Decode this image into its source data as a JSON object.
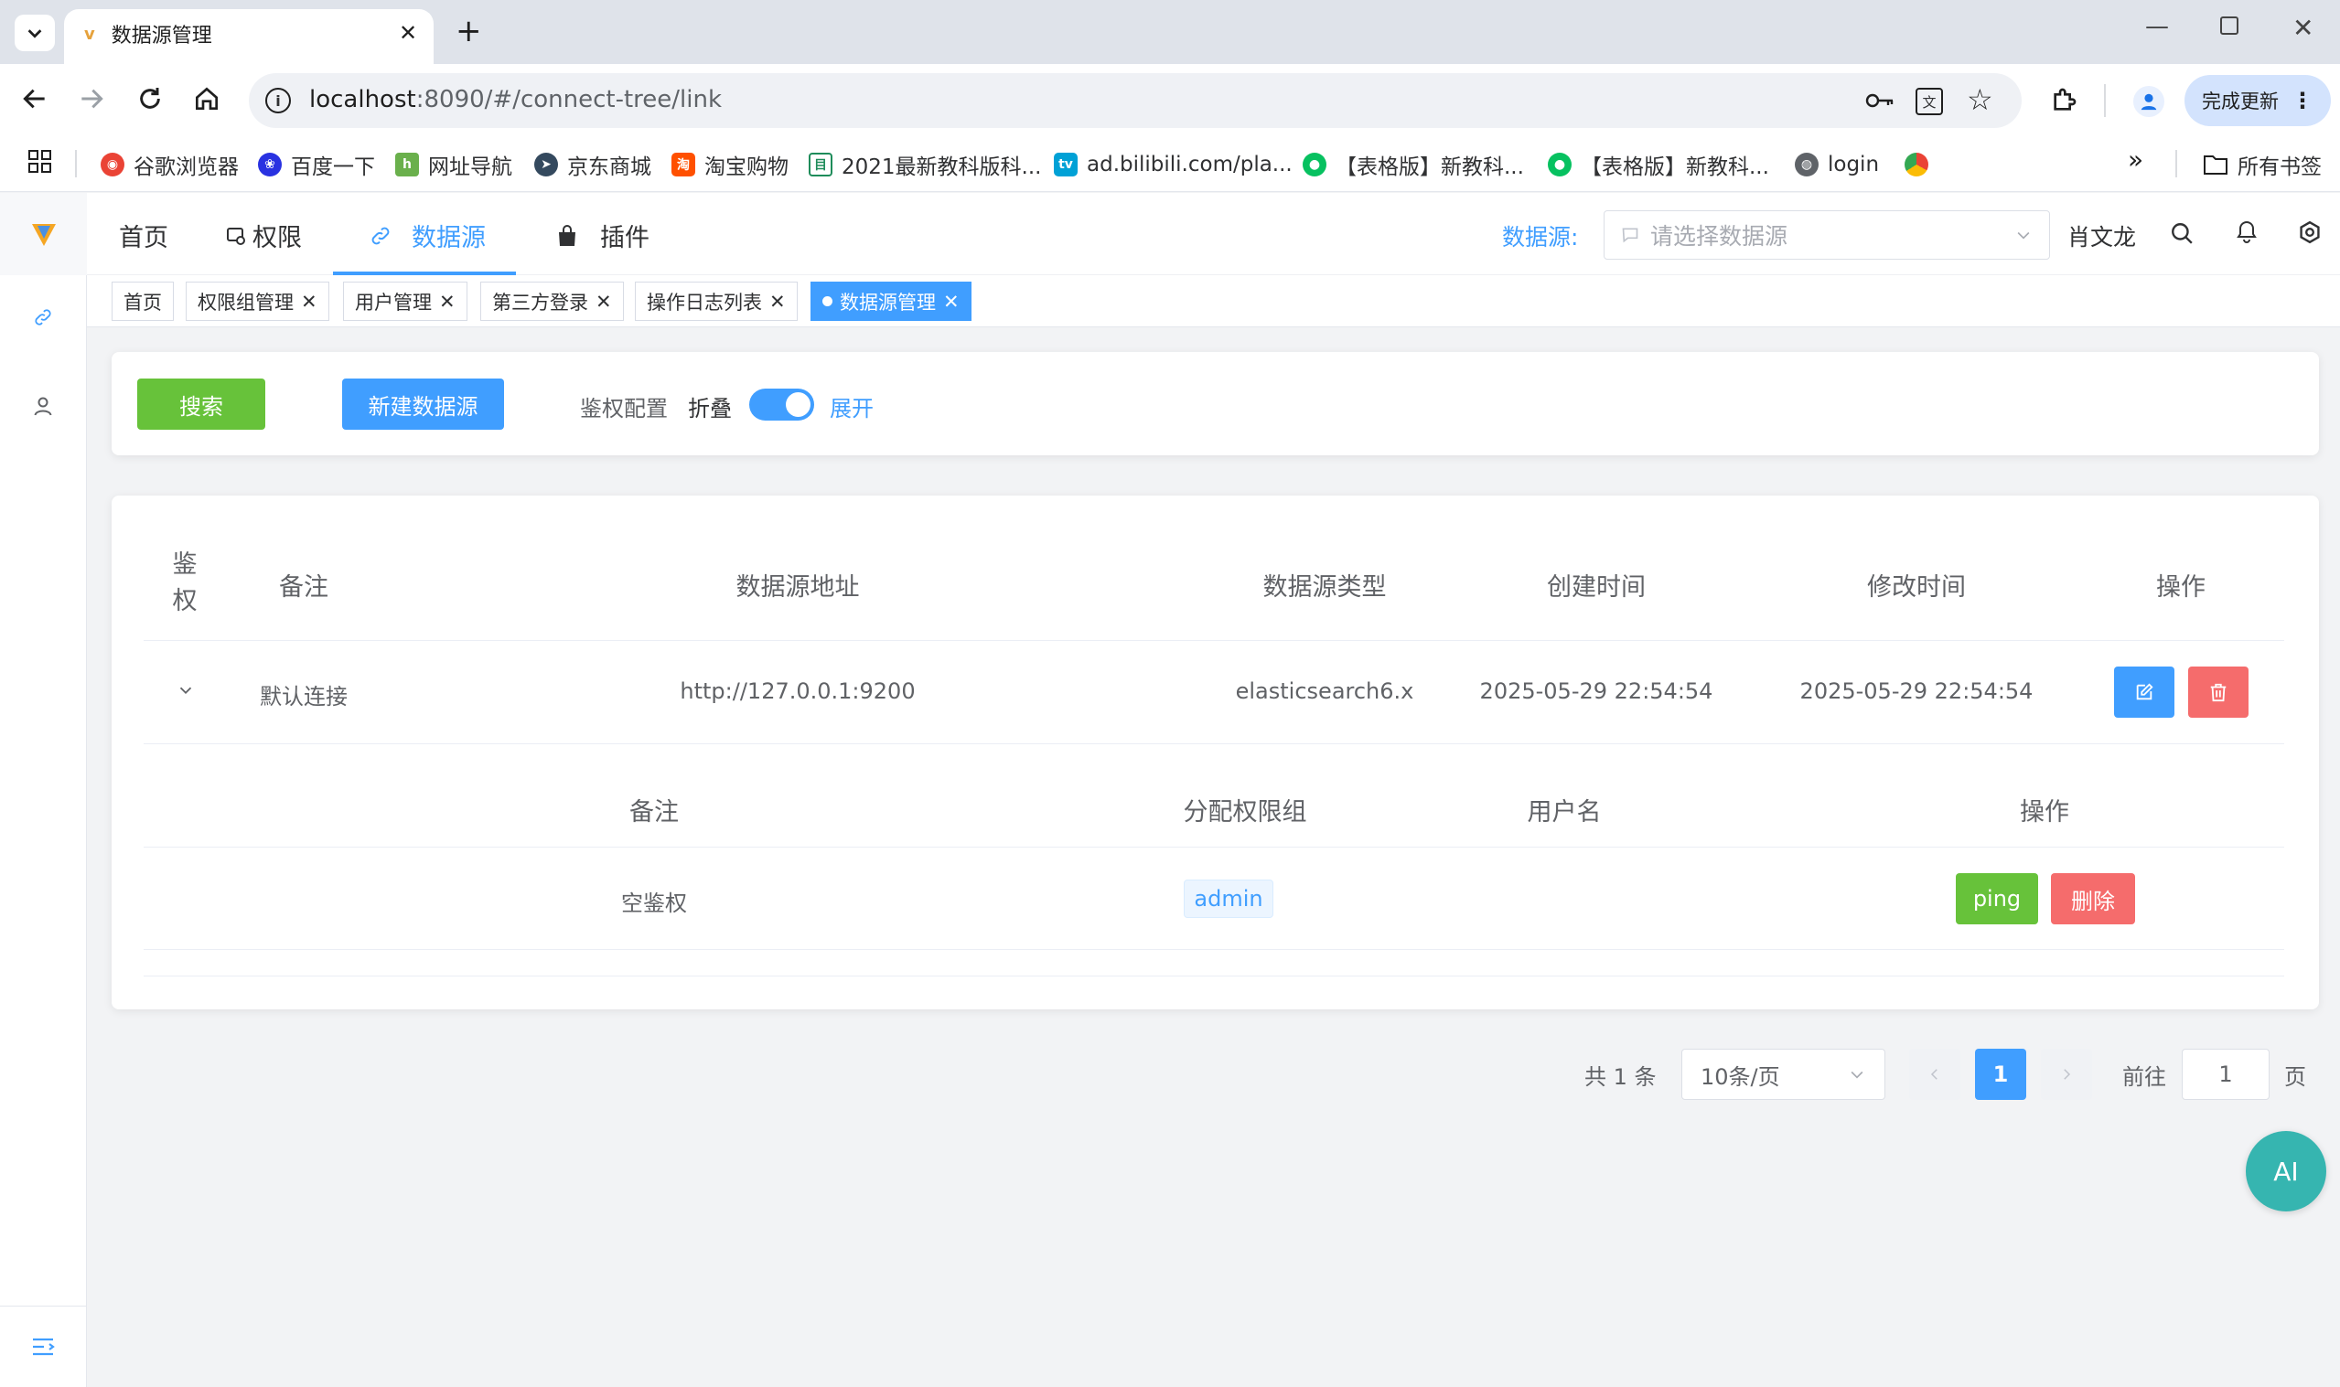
{
  "browser": {
    "tab_title": "数据源管理",
    "url_host": "localhost",
    "url_rest": ":8090/#/connect-tree/link",
    "update_label": "完成更新",
    "bookmarks": [
      "谷歌浏览器",
      "百度一下",
      "网址导航",
      "京东商城",
      "淘宝购物",
      "2021最新教科版科...",
      "ad.bilibili.com/pla...",
      "【表格版】新教科...",
      "【表格版】新教科...",
      "login"
    ],
    "all_bookmarks": "所有书签"
  },
  "nav": {
    "items": [
      "首页",
      "权限",
      "数据源",
      "插件"
    ],
    "active": "数据源",
    "datasource_label": "数据源:",
    "datasource_placeholder": "请选择数据源",
    "username": "肖文龙"
  },
  "tags": [
    "首页",
    "权限组管理",
    "用户管理",
    "第三方登录",
    "操作日志列表",
    "数据源管理"
  ],
  "toolbar": {
    "search_label": "搜索",
    "new_label": "新建数据源",
    "auth_config_label": "鉴权配置",
    "fold_label": "折叠",
    "expand_label": "展开",
    "toggle_on": true
  },
  "table": {
    "headers": [
      "鉴权",
      "备注",
      "数据源地址",
      "数据源类型",
      "创建时间",
      "修改时间",
      "操作"
    ],
    "rows": [
      {
        "remark": "默认连接",
        "address": "http://127.0.0.1:9200",
        "type": "elasticsearch6.x",
        "created": "2025-05-29 22:54:54",
        "modified": "2025-05-29 22:54:54"
      }
    ],
    "sub": {
      "headers": [
        "备注",
        "分配权限组",
        "用户名",
        "操作"
      ],
      "rows": [
        {
          "remark": "空鉴权",
          "group": "admin",
          "username": "",
          "ping_label": "ping",
          "delete_label": "删除"
        }
      ]
    }
  },
  "pagination": {
    "total": "共 1 条",
    "page_size": "10条/页",
    "current": "1",
    "goto_label": "前往",
    "goto_value": "1",
    "page_suffix": "页"
  },
  "ai_label": "AI",
  "colors": {
    "primary": "#409eff",
    "success": "#67c23a",
    "danger": "#f56c6c",
    "ai": "#36b5b0"
  }
}
